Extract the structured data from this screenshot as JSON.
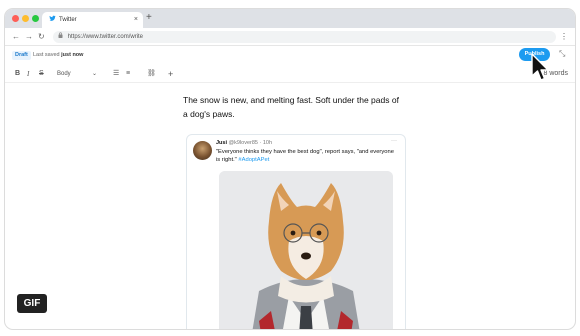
{
  "browser": {
    "tab_title": "Twitter",
    "new_tab": "+",
    "tab_close": "×",
    "url": "https://www.twitter.com/write",
    "nav": {
      "back": "←",
      "forward": "→",
      "reload": "↻"
    },
    "menu": "⋮"
  },
  "editor": {
    "status_badge": "Draft",
    "saved_prefix": "Last saved",
    "saved_time": "just now",
    "publish_label": "Publish",
    "expand_icon": "⤡",
    "toolbar": {
      "bold": "B",
      "italic": "I",
      "strike": "S",
      "style_value": "Body",
      "style_chevron": "⌄",
      "bullet_list": "☰",
      "numbered_list": "≡",
      "link": "⛓",
      "insert": "+"
    },
    "word_count": "8 words",
    "body": "The snow is new, and melting fast. Soft under the pads of a dog's paws."
  },
  "tweet": {
    "name": "Jusi",
    "handle": "@k9lover85",
    "time": "10h",
    "more": "···",
    "text": "\"Everyone thinks they have the best dog\", report says, \"and everyone is right.\"",
    "hashtag": "#AdoptAPet"
  },
  "overlay": {
    "gif_label": "GIF"
  },
  "colors": {
    "accent": "#1d9bf0",
    "draft_text": "#1d7acb",
    "close": "#fe5f57",
    "minimize": "#febc2e",
    "zoom": "#28c840"
  }
}
